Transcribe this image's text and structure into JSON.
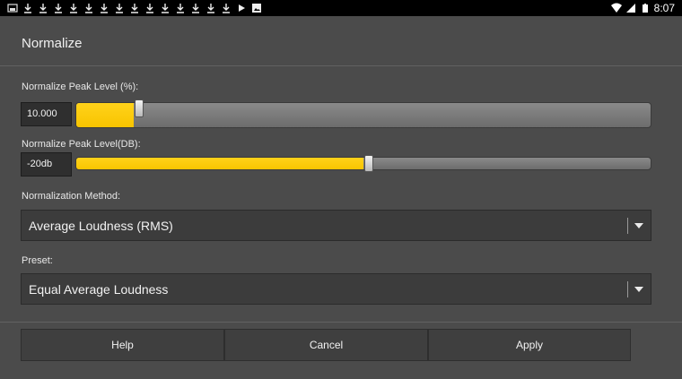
{
  "status_bar": {
    "time": "8:07",
    "left_icons": [
      "screenshot-icon",
      "download-icon",
      "download-icon",
      "download-icon",
      "download-icon",
      "download-icon",
      "download-icon",
      "download-icon",
      "download-icon",
      "download-icon",
      "download-icon",
      "download-icon",
      "download-icon",
      "download-icon",
      "download-icon",
      "play-store-icon",
      "image-icon"
    ],
    "right_icons": [
      "wifi-icon",
      "cell-signal-icon",
      "battery-icon"
    ]
  },
  "dialog": {
    "title": "Normalize",
    "peak_percent": {
      "label": "Normalize Peak Level (%):",
      "value": "10.000",
      "slider_fraction": 0.1
    },
    "peak_db": {
      "label": "Normalize Peak Level(DB):",
      "value": "-20db",
      "slider_fraction": 0.5
    },
    "method": {
      "label": "Normalization Method:",
      "selected": "Average Loudness (RMS)"
    },
    "preset": {
      "label": "Preset:",
      "selected": "Equal Average Loudness"
    },
    "buttons": {
      "help": "Help",
      "cancel": "Cancel",
      "apply": "Apply"
    }
  },
  "colors": {
    "accent": "#f8c400",
    "background": "#4b4b4b",
    "status_bar": "#000000"
  }
}
